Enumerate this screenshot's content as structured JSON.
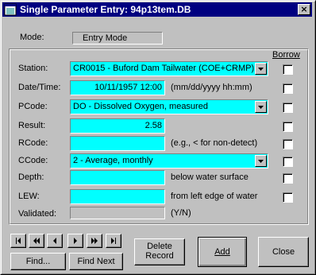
{
  "window": {
    "title": "Single Parameter Entry: 94p13tem.DB",
    "close_glyph": "×"
  },
  "mode": {
    "label": "Mode:",
    "value": "Entry Mode"
  },
  "borrow_header": "Borrow",
  "fields": {
    "station": {
      "label": "Station:",
      "value": "CR0015 - Buford Dam Tailwater (COE+CRMP)"
    },
    "datetime": {
      "label": "Date/Time:",
      "value": "10/11/1957 12:00",
      "hint": "(mm/dd/yyyy hh:mm)"
    },
    "pcode": {
      "label": "PCode:",
      "value": "DO - Dissolved Oxygen, measured"
    },
    "result": {
      "label": "Result:",
      "value": "2.58"
    },
    "rcode": {
      "label": "RCode:",
      "value": "",
      "hint": "(e.g., < for non-detect)"
    },
    "ccode": {
      "label": "CCode:",
      "value": "2 - Average, monthly"
    },
    "depth": {
      "label": "Depth:",
      "value": "",
      "hint": "below water surface"
    },
    "lew": {
      "label": "LEW:",
      "value": "",
      "hint": "from left edge of water"
    },
    "validated": {
      "label": "Validated:",
      "value": "",
      "hint": "(Y/N)"
    }
  },
  "buttons": {
    "find": "Find...",
    "find_next": "Find Next",
    "delete_line1": "Delete",
    "delete_line2": "Record",
    "add": "Add",
    "close": "Close"
  },
  "nav_icons": [
    "first-record-icon",
    "prev-page-icon",
    "prev-record-icon",
    "next-record-icon",
    "next-page-icon",
    "last-record-icon"
  ],
  "colors": {
    "title_bar": "#000080",
    "field_bg": "#00ffff",
    "face": "#c0c0c0"
  }
}
